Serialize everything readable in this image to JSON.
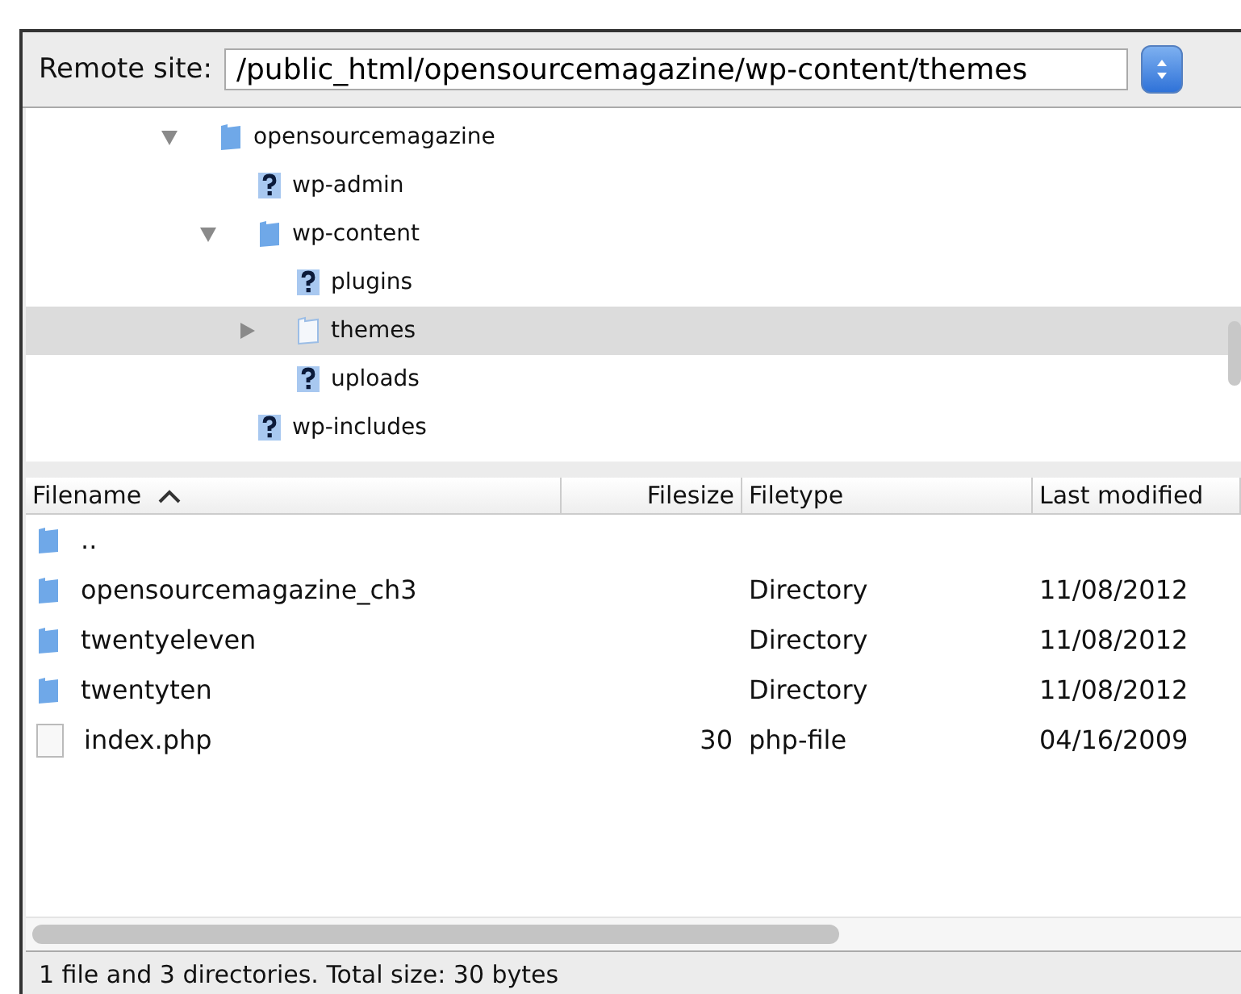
{
  "remote_site": {
    "label": "Remote site:",
    "value": "/public_html/opensourcemagazine/wp-content/themes"
  },
  "tree": [
    {
      "label": "opensourcemagazine",
      "kind": "folder",
      "expanded": true,
      "selected": false,
      "children": [
        {
          "label": "wp-admin",
          "kind": "unknown",
          "selected": false
        },
        {
          "label": "wp-content",
          "kind": "folder",
          "expanded": true,
          "selected": false,
          "children": [
            {
              "label": "plugins",
              "kind": "unknown",
              "selected": false
            },
            {
              "label": "themes",
              "kind": "folder",
              "expanded": false,
              "selected": true
            },
            {
              "label": "uploads",
              "kind": "unknown",
              "selected": false
            }
          ]
        },
        {
          "label": "wp-includes",
          "kind": "unknown",
          "selected": false
        }
      ]
    }
  ],
  "table": {
    "columns": [
      {
        "label": "Filename",
        "sorted": true
      },
      {
        "label": "Filesize",
        "sorted": false
      },
      {
        "label": "Filetype",
        "sorted": false
      },
      {
        "label": "Last modified",
        "sorted": false
      }
    ],
    "rows": [
      {
        "kind": "folder",
        "name": "..",
        "size": "",
        "type": "",
        "modified": ""
      },
      {
        "kind": "folder",
        "name": "opensourcemagazine_ch3",
        "size": "",
        "type": "Directory",
        "modified": "11/08/2012"
      },
      {
        "kind": "folder",
        "name": "twentyeleven",
        "size": "",
        "type": "Directory",
        "modified": "11/08/2012"
      },
      {
        "kind": "folder",
        "name": "twentyten",
        "size": "",
        "type": "Directory",
        "modified": "11/08/2012"
      },
      {
        "kind": "file",
        "name": "index.php",
        "size": "30",
        "type": "php-file",
        "modified": "04/16/2009"
      }
    ]
  },
  "status_bar": "1 file and 3 directories. Total size: 30 bytes"
}
